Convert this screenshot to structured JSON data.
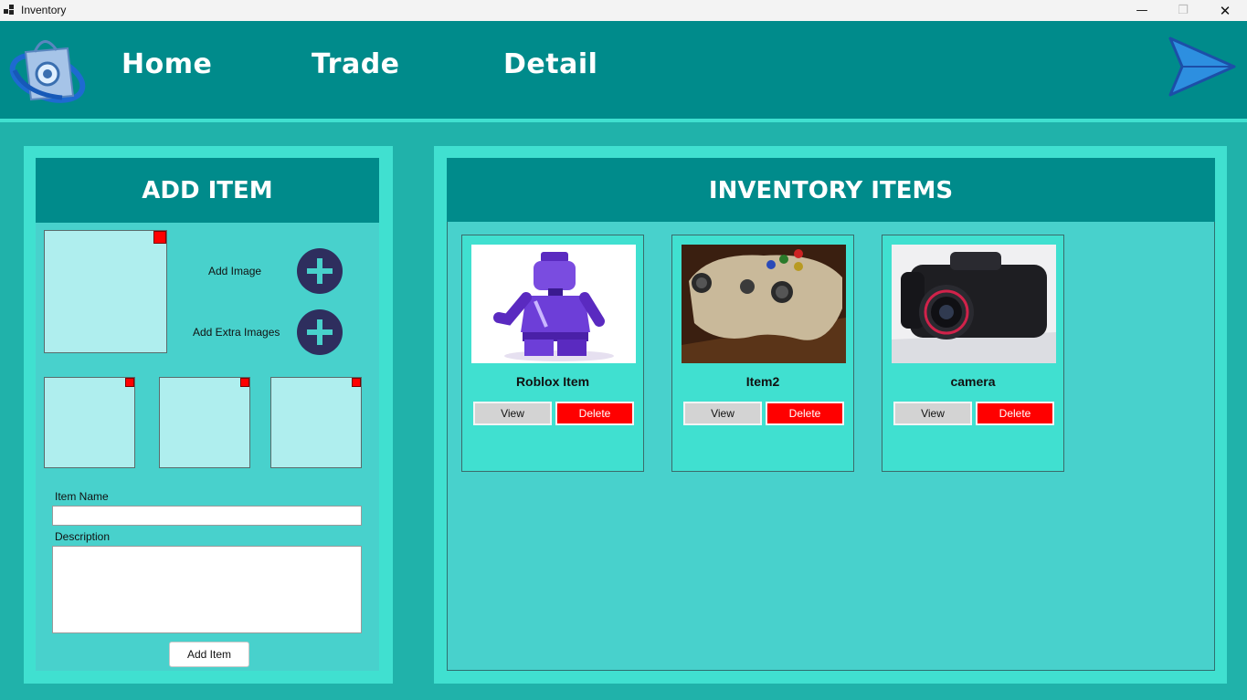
{
  "window": {
    "title": "Inventory",
    "minimize_glyph": "—",
    "restore_glyph": "❐",
    "close_glyph": "✕"
  },
  "nav": {
    "home": "Home",
    "trade": "Trade",
    "detail": "Detail"
  },
  "icons": {
    "logo": "shopping-bag-logo-icon",
    "send": "send-arrow-icon",
    "add": "plus-circle-icon"
  },
  "add_item": {
    "heading": "ADD ITEM",
    "add_image_label": "Add Image",
    "add_extra_images_label": "Add Extra Images",
    "item_name_label": "Item Name",
    "item_name_value": "",
    "description_label": "Description",
    "description_value": "",
    "submit_label": "Add Item"
  },
  "inventory": {
    "heading": "INVENTORY ITEMS",
    "items": [
      {
        "name": "Roblox Item",
        "view_label": "View",
        "delete_label": "Delete"
      },
      {
        "name": "Item2",
        "view_label": "View",
        "delete_label": "Delete"
      },
      {
        "name": "camera",
        "view_label": "View",
        "delete_label": "Delete"
      }
    ]
  },
  "colors": {
    "header": "#008b8b",
    "accent": "#40e0d0",
    "panel": "#48d1cc",
    "background": "#20b2aa",
    "image_box": "#afeeee",
    "delete": "#ff0000"
  }
}
